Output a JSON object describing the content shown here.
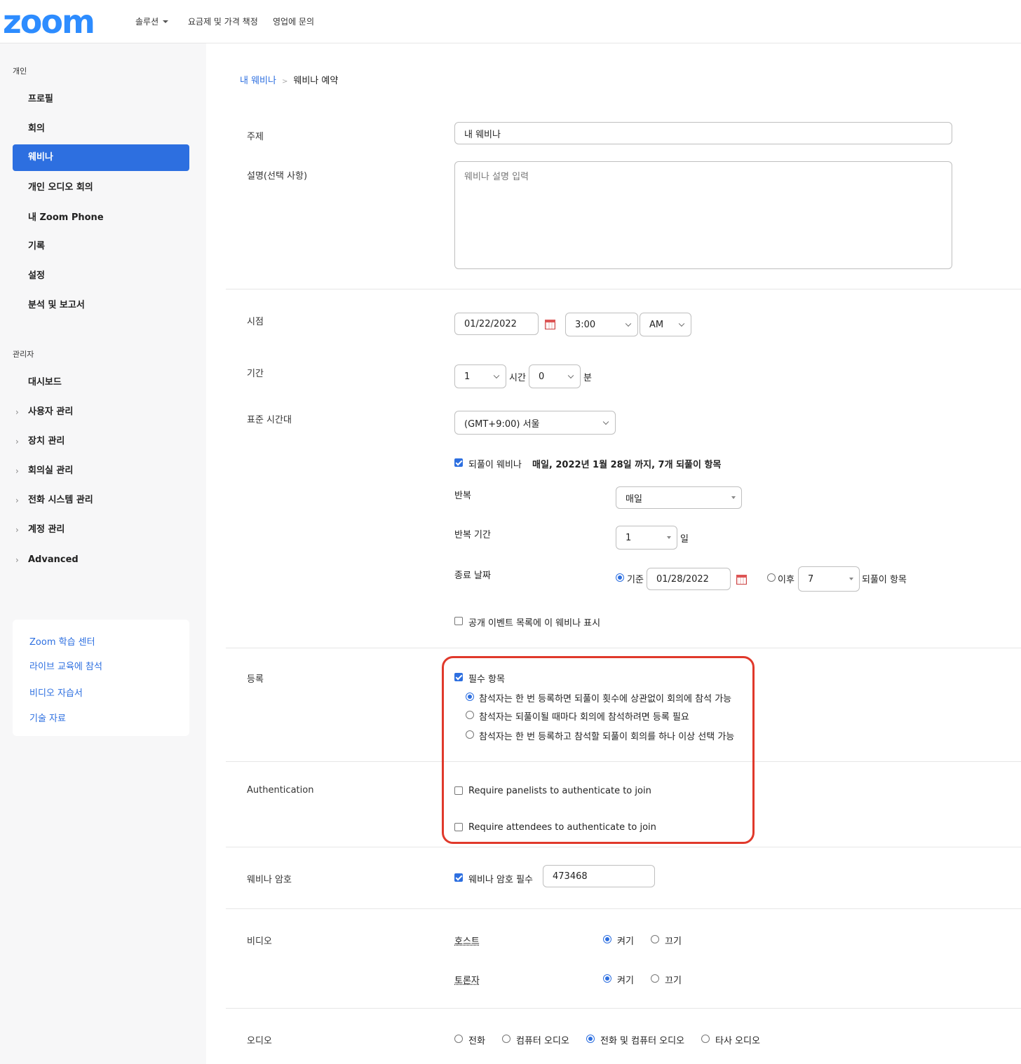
{
  "header": {
    "logo": "zoom",
    "nav": [
      "솔루션",
      "요금제 및 가격 책정",
      "영업에 문의"
    ]
  },
  "sidebar": {
    "personal_title": "개인",
    "personal_items": [
      "프로필",
      "회의",
      "웨비나",
      "개인 오디오 회의",
      "내 Zoom Phone",
      "기록",
      "설정",
      "분석 및 보고서"
    ],
    "active": "웨비나",
    "admin_title": "관리자",
    "admin_items": [
      "대시보드",
      "사용자 관리",
      "장치 관리",
      "회의실 관리",
      "전화 시스템 관리",
      "계정 관리",
      "Advanced"
    ],
    "learn_links": [
      "Zoom 학습 센터",
      "라이브 교육에 참석",
      "비디오 자습서",
      "기술 자료"
    ]
  },
  "breadcrumb": {
    "link": "내 웨비나",
    "current": "웨비나 예약"
  },
  "form": {
    "topic": {
      "label": "주제",
      "value": "내 웨비나"
    },
    "description": {
      "label": "설명(선택 사항)",
      "placeholder": "웨비나 설명 입력"
    },
    "when": {
      "label": "시점",
      "date": "01/22/2022",
      "time": "3:00",
      "ampm": "AM"
    },
    "duration": {
      "label": "기간",
      "hours": "1",
      "hours_unit": "시간",
      "minutes": "0",
      "minutes_unit": "분"
    },
    "timezone": {
      "label": "표준 시간대",
      "value": "(GMT+9:00) 서울"
    },
    "recurring": {
      "checkbox_label": "되풀이 웨비나",
      "checked": true,
      "summary": "매일, 2022년 1월 28일 까지, 7개 되풀이 항목",
      "repeat_label": "반복",
      "repeat_value": "매일",
      "interval_label": "반복 기간",
      "interval_value": "1",
      "interval_unit": "일",
      "end_label": "종료 날짜",
      "end_by_label": "기준",
      "end_by_date": "01/28/2022",
      "end_after_label": "이후",
      "end_after_value": "7",
      "end_after_unit": "되풀이 항목"
    },
    "public_list": {
      "label": "공개 이벤트 목록에 이 웨비나 표시",
      "checked": false
    },
    "registration": {
      "label": "등록",
      "required_label": "필수 항목",
      "required": true,
      "options": [
        "참석자는 한 번 등록하면 되풀이 횟수에 상관없이 회의에 참석 가능",
        "참석자는 되풀이될 때마다 회의에 참석하려면 등록 필요",
        "참석자는 한 번 등록하고 참석할 되풀이 회의를 하나 이상 선택 가능"
      ],
      "selected": 0
    },
    "authentication": {
      "label": "Authentication",
      "panelists": "Require panelists to authenticate to join",
      "attendees": "Require attendees to authenticate to join"
    },
    "passcode": {
      "label": "웨비나 암호",
      "checkbox_label": "웨비나 암호 필수",
      "checked": true,
      "value": "473468"
    },
    "video": {
      "label": "비디오",
      "host_label": "호스트",
      "panelist_label": "토론자",
      "on": "켜기",
      "off": "끄기",
      "host": "on",
      "panelist": "on"
    },
    "audio": {
      "label": "오디오",
      "options": [
        "전화",
        "컴퓨터 오디오",
        "전화 및 컴퓨터 오디오",
        "타사 오디오"
      ],
      "selected": 2
    }
  },
  "colors": {
    "accent": "#2d6fe0",
    "highlight": "#e0392b",
    "sidebar_bg": "#f7f7f8"
  }
}
